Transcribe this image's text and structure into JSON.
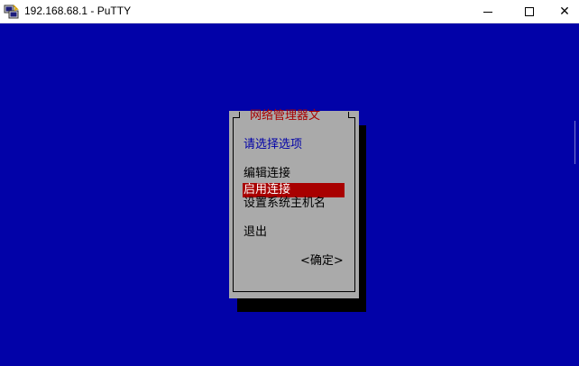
{
  "window": {
    "title": "192.168.68.1 - PuTTY",
    "close_glyph": "✕"
  },
  "dialog": {
    "title": "网络管理器文",
    "prompt": "请选择选项",
    "menu_items": [
      {
        "label": "编辑连接",
        "selected": false
      },
      {
        "label": "启用连接",
        "selected": true
      },
      {
        "label": "设置系统主机名",
        "selected": false
      },
      {
        "label": "退出",
        "selected": false
      }
    ],
    "ok_button": "<确定>"
  },
  "colors": {
    "terminal_bg": "#0202a8",
    "dialog_bg": "#aaaaaa",
    "selection_bg": "#a80000",
    "title_text": "#a80000",
    "prompt_text": "#0000a8"
  }
}
